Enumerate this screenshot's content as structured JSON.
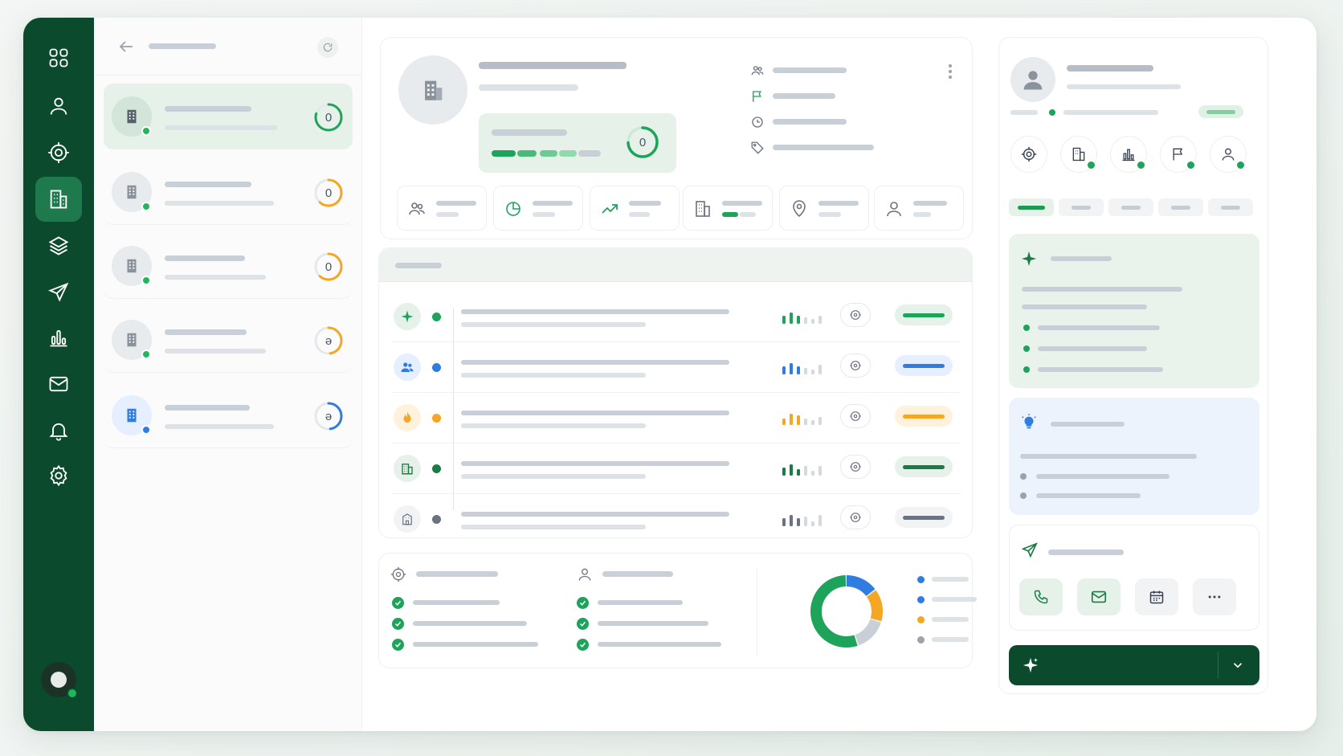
{
  "rail": {
    "items": [
      {
        "icon": "grid-icon"
      },
      {
        "icon": "user-icon"
      },
      {
        "icon": "target-icon"
      },
      {
        "icon": "building-icon",
        "active": true
      },
      {
        "icon": "layers-icon"
      },
      {
        "icon": "send-icon"
      },
      {
        "icon": "bar-chart-icon"
      },
      {
        "icon": "mail-icon"
      },
      {
        "icon": "bell-icon"
      },
      {
        "icon": "settings-icon"
      }
    ]
  },
  "list": {
    "items": [
      {
        "score": "0",
        "color": "#1ea35a",
        "presence": "#22b55e"
      },
      {
        "score": "0",
        "color": "#f5a623",
        "presence": "#22b55e"
      },
      {
        "score": "0",
        "color": "#f5a623",
        "presence": "#22b55e"
      },
      {
        "score": "ə",
        "color": "#f5a623",
        "presence": "#22b55e"
      },
      {
        "score": "ə",
        "color": "#2f7de1",
        "presence": "#2f7de1"
      }
    ]
  },
  "profile": {
    "score": "0"
  },
  "colors": {
    "brand_dark": "#0b4a2c",
    "accent_green": "#1ea35a",
    "accent_blue": "#2f7de1",
    "accent_orange": "#f5a623",
    "neutral_gray": "#6b7280"
  },
  "feed": {
    "rows": [
      {
        "icon": "sparkle-icon",
        "color": "#1ea35a"
      },
      {
        "icon": "users-icon",
        "color": "#2f7de1"
      },
      {
        "icon": "flame-icon",
        "color": "#f5a623"
      },
      {
        "icon": "building-icon",
        "color": "#1b7a45"
      },
      {
        "icon": "building-outline-icon",
        "color": "#6b7280"
      }
    ]
  },
  "chart_data": {
    "type": "pie",
    "values": [
      55,
      15,
      15,
      15
    ],
    "colors": [
      "#1ea35a",
      "#2f7de1",
      "#f5a623",
      "#c9cfd6"
    ]
  }
}
